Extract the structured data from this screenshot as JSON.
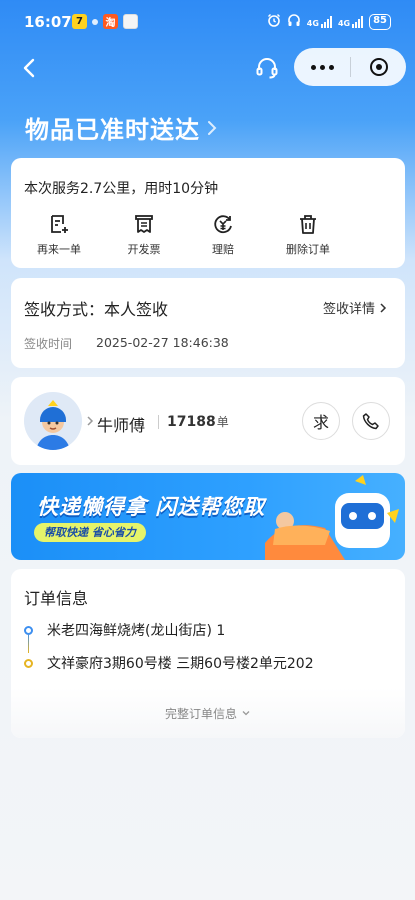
{
  "status_bar": {
    "time": "16:07",
    "net_left": "4G",
    "net_right": "4G",
    "battery": "85"
  },
  "page": {
    "title": "物品已准时送达"
  },
  "service": {
    "summary": "本次服务2.7公里，用时10分钟",
    "actions": [
      {
        "label": "再来一单",
        "icon": "reorder-icon"
      },
      {
        "label": "开发票",
        "icon": "invoice-icon"
      },
      {
        "label": "理赔",
        "icon": "claim-icon"
      },
      {
        "label": "删除订单",
        "icon": "trash-icon"
      }
    ]
  },
  "sign": {
    "method": "签收方式：本人签收",
    "detail_label": "签收详情",
    "time_label": "签收时间",
    "time_value": "2025-02-27 18:46:38"
  },
  "courier": {
    "name": "牛师傅",
    "order_count": "17188",
    "order_unit": "单",
    "ask_label": "求"
  },
  "banner": {
    "title": "快递懒得拿 闪送帮您取",
    "subtitle": "帮取快递  省心省力"
  },
  "order_info": {
    "title": "订单信息",
    "from": "米老四海鲜烧烤(龙山街店) 1",
    "to": "文祥豪府3期60号楼 三期60号楼2单元202",
    "more_label": "完整订单信息",
    "from_color": "#3d8ff0",
    "to_color": "#e6b422"
  }
}
